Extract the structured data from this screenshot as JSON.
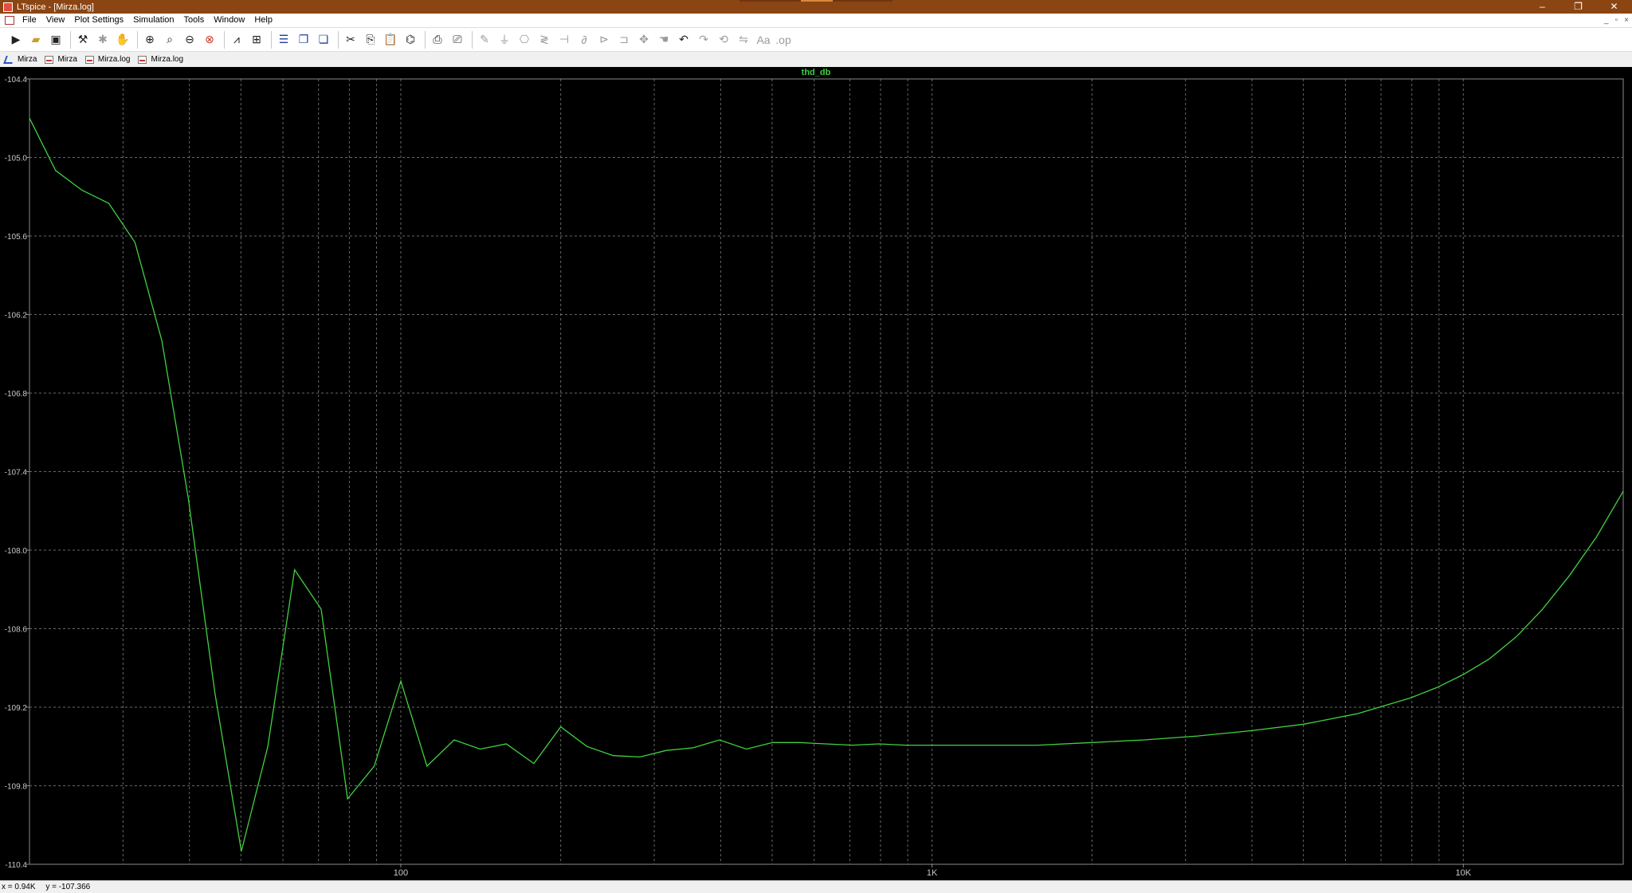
{
  "window": {
    "title": "LTspice - [Mirza.log]",
    "controls": [
      "–",
      "❐",
      "✕"
    ]
  },
  "menu": [
    "File",
    "View",
    "Plot Settings",
    "Simulation",
    "Tools",
    "Window",
    "Help"
  ],
  "mdi_controls": [
    "_",
    "▫",
    "×"
  ],
  "toolbar_icons": [
    "run-icon",
    "open-icon",
    "save-icon",
    "control-panel-icon",
    "halt-icon",
    "pan-icon",
    "zoom-in-icon",
    "zoom-area-icon",
    "zoom-out-icon",
    "zoom-full-icon",
    "autorange-icon",
    "tile-vertical-icon",
    "tile-horizontal-icon",
    "cascade-icon",
    "cut-icon",
    "copy-icon",
    "paste-icon",
    "find-icon",
    "print-icon",
    "print-preview-icon",
    "wire-icon",
    "ground-icon",
    "label-icon",
    "resistor-icon",
    "capacitor-icon",
    "inductor-icon",
    "diode-icon",
    "component-icon",
    "move-icon",
    "drag-icon",
    "undo-icon",
    "redo-icon",
    "rotate-icon",
    "mirror-icon",
    "text-icon",
    "spice-directive-icon"
  ],
  "tabs": [
    {
      "label": "Mirza",
      "icon": "schematic-icon"
    },
    {
      "label": "Mirza",
      "icon": "plot-icon"
    },
    {
      "label": "Mirza.log",
      "icon": "plot-icon"
    },
    {
      "label": "Mirza.log",
      "icon": "plot-icon"
    }
  ],
  "status": {
    "x": "x = 0.94K",
    "y": "y = -107.366"
  },
  "colors": {
    "trace": "#40d040",
    "grid": "#8a8a8a",
    "background": "#000000",
    "axis_text": "#c8c8c8"
  },
  "chart_data": {
    "type": "line",
    "title": "thd_db",
    "xscale": "log",
    "grid": true,
    "xlim": [
      20,
      20000
    ],
    "ylim": [
      -110.4,
      -104.4
    ],
    "xticks": [
      {
        "value": 100,
        "label": "100"
      },
      {
        "value": 1000,
        "label": "1K"
      },
      {
        "value": 10000,
        "label": "10K"
      }
    ],
    "yticks": [
      -104.4,
      -105.0,
      -105.6,
      -106.2,
      -106.8,
      -107.4,
      -108.0,
      -108.6,
      -109.2,
      -109.8,
      -110.4
    ],
    "ytick_labels": [
      "-104.4",
      "-105.0",
      "-105.6",
      "-106.2",
      "-106.8",
      "-107.4",
      "-108.0",
      "-108.6",
      "-109.2",
      "-109.8",
      "-110.4"
    ],
    "series": [
      {
        "x": [
          20,
          22.4,
          25.1,
          28.2,
          31.6,
          35.5,
          39.8,
          44.7,
          50.1,
          56.2,
          63.1,
          70.8,
          79.4,
          89.1,
          100,
          112,
          126,
          141,
          158,
          178,
          200,
          224,
          251,
          282,
          316,
          355,
          398,
          447,
          501,
          562,
          631,
          708,
          794,
          891,
          1000,
          1260,
          1580,
          2000,
          2510,
          3160,
          3980,
          5010,
          6310,
          7080,
          7940,
          8910,
          10000,
          11200,
          12600,
          14100,
          15800,
          17800,
          20000
        ],
        "y": [
          -104.7,
          -105.1,
          -105.25,
          -105.35,
          -105.65,
          -106.4,
          -107.6,
          -109.1,
          -110.3,
          -109.5,
          -108.15,
          -108.45,
          -109.9,
          -109.65,
          -109.0,
          -109.65,
          -109.45,
          -109.52,
          -109.48,
          -109.63,
          -109.35,
          -109.5,
          -109.57,
          -109.58,
          -109.53,
          -109.51,
          -109.45,
          -109.52,
          -109.47,
          -109.47,
          -109.48,
          -109.49,
          -109.48,
          -109.49,
          -109.49,
          -109.49,
          -109.49,
          -109.47,
          -109.45,
          -109.42,
          -109.38,
          -109.33,
          -109.25,
          -109.19,
          -109.13,
          -109.05,
          -108.95,
          -108.83,
          -108.66,
          -108.45,
          -108.2,
          -107.9,
          -107.55
        ]
      }
    ]
  }
}
